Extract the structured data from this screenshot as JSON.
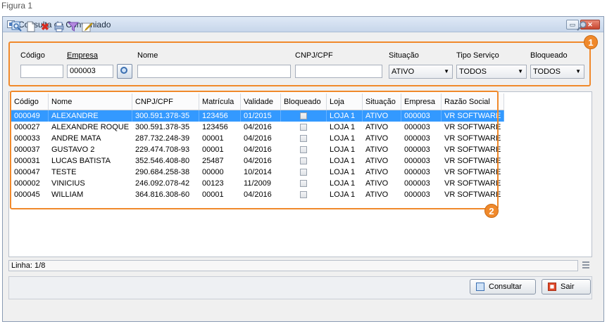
{
  "caption": "Figura 1",
  "window": {
    "title": "Consulta de Conveniado",
    "minimize_glyph": "▭",
    "close_glyph": "✕"
  },
  "toolbar": {
    "icons": [
      "search-icon",
      "new-document-icon",
      "delete-icon",
      "print-icon",
      "filter-icon",
      "edit-icon"
    ],
    "right_icon": "key-icon"
  },
  "badges": {
    "one": "1",
    "two": "2"
  },
  "filters": {
    "codigo_label": "Código",
    "codigo_value": "",
    "empresa_label": "Empresa",
    "empresa_value": "000003",
    "nome_label": "Nome",
    "nome_value": "",
    "cnpj_label": "CNPJ/CPF",
    "cnpj_value": "",
    "situacao_label": "Situação",
    "situacao_value": "ATIVO",
    "tipo_servico_label": "Tipo Serviço",
    "tipo_servico_value": "TODOS",
    "bloqueado_label": "Bloqueado",
    "bloqueado_value": "TODOS"
  },
  "grid": {
    "columns": [
      "Código",
      "Nome",
      "CNPJ/CPF",
      "Matrícula",
      "Validade",
      "Bloqueado",
      "Loja",
      "Situação",
      "Empresa",
      "Razão Social"
    ],
    "rows": [
      {
        "codigo": "000049",
        "nome": "ALEXANDRE",
        "cnpj": "300.591.378-35",
        "matricula": "123456",
        "validade": "01/2015",
        "loja": "LOJA 1",
        "situacao": "ATIVO",
        "empresa": "000003",
        "razao": "VR SOFTWARE"
      },
      {
        "codigo": "000027",
        "nome": "ALEXANDRE ROQUE",
        "cnpj": "300.591.378-35",
        "matricula": "123456",
        "validade": "04/2016",
        "loja": "LOJA 1",
        "situacao": "ATIVO",
        "empresa": "000003",
        "razao": "VR SOFTWARE"
      },
      {
        "codigo": "000033",
        "nome": "ANDRE MATA",
        "cnpj": "287.732.248-39",
        "matricula": "00001",
        "validade": "04/2016",
        "loja": "LOJA 1",
        "situacao": "ATIVO",
        "empresa": "000003",
        "razao": "VR SOFTWARE"
      },
      {
        "codigo": "000037",
        "nome": "GUSTAVO 2",
        "cnpj": "229.474.708-93",
        "matricula": "00001",
        "validade": "04/2016",
        "loja": "LOJA 1",
        "situacao": "ATIVO",
        "empresa": "000003",
        "razao": "VR SOFTWARE"
      },
      {
        "codigo": "000031",
        "nome": "LUCAS BATISTA",
        "cnpj": "352.546.408-80",
        "matricula": "25487",
        "validade": "04/2016",
        "loja": "LOJA 1",
        "situacao": "ATIVO",
        "empresa": "000003",
        "razao": "VR SOFTWARE"
      },
      {
        "codigo": "000047",
        "nome": "TESTE",
        "cnpj": "290.684.258-38",
        "matricula": "00000",
        "validade": "10/2014",
        "loja": "LOJA 1",
        "situacao": "ATIVO",
        "empresa": "000003",
        "razao": "VR SOFTWARE"
      },
      {
        "codigo": "000002",
        "nome": "VINICIUS",
        "cnpj": "246.092.078-42",
        "matricula": "00123",
        "validade": "11/2009",
        "loja": "LOJA 1",
        "situacao": "ATIVO",
        "empresa": "000003",
        "razao": "VR SOFTWARE"
      },
      {
        "codigo": "000045",
        "nome": "WILLIAM",
        "cnpj": "364.816.308-60",
        "matricula": "00001",
        "validade": "04/2016",
        "loja": "LOJA 1",
        "situacao": "ATIVO",
        "empresa": "000003",
        "razao": "VR SOFTWARE"
      }
    ]
  },
  "status": {
    "linha": "Linha: 1/8"
  },
  "buttons": {
    "consultar": "Consultar",
    "sair": "Sair"
  }
}
